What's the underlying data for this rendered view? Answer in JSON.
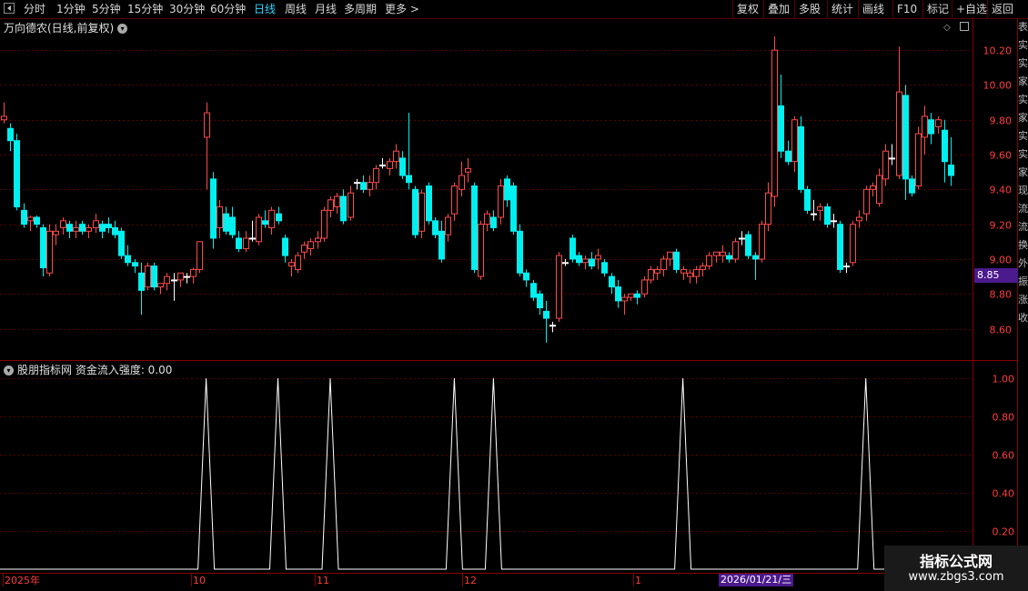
{
  "toolbar": {
    "left_items": [
      "分时",
      "1分钟",
      "5分钟",
      "15分钟",
      "30分钟",
      "60分钟",
      "日线",
      "周线",
      "月线",
      "多周期",
      "更多 >"
    ],
    "active": "日线",
    "right_items": [
      "复权",
      "叠加",
      "多股",
      "统计",
      "画线",
      "F10",
      "标记",
      "+自选",
      "返回"
    ]
  },
  "main_chart": {
    "title": "万向德农(日线,前复权)",
    "price_labels": [
      "10.20",
      "10.00",
      "9.80",
      "9.60",
      "9.40",
      "9.20",
      "9.00",
      "8.80",
      "8.60"
    ],
    "current_price": "8.85"
  },
  "indicator": {
    "title": "股朋指标网 资金流入强度: 0.00",
    "labels": [
      "1.00",
      "0.80",
      "0.60",
      "0.40",
      "0.20"
    ]
  },
  "x_axis": {
    "labels": [
      "2025年",
      "10",
      "11",
      "12",
      "1"
    ],
    "cursor_date": "2026/01/21/三"
  },
  "watermark": {
    "line1": "指标公式网",
    "line2": "www.zbgs3.com"
  },
  "right_panel_chars": [
    "表",
    "实",
    "实",
    "家",
    "实",
    "家",
    "实",
    "实",
    "家",
    "现",
    "流",
    "流",
    "换",
    "外",
    "振",
    "涨",
    "收"
  ],
  "colors": {
    "up": "#ff4a4a",
    "down": "#00f0f0",
    "neutral": "#ffffff",
    "grid": "#5a0000",
    "axis_text": "#ff3c3c",
    "active_tab": "#2dd4ff",
    "highlight": "#4b1a8c"
  },
  "chart_data": [
    {
      "type": "candlestick",
      "title": "万向德农(日线,前复权)",
      "ylim": [
        8.42,
        10.3
      ],
      "y_ticks": [
        10.2,
        10.0,
        9.8,
        9.6,
        9.4,
        9.2,
        9.0,
        8.8,
        8.6
      ],
      "current_price": 8.85,
      "x_tick_labels": [
        "2025年",
        "10",
        "11",
        "12",
        "1"
      ],
      "ohlc": [
        [
          9.8,
          9.9,
          9.78,
          9.82
        ],
        [
          9.75,
          9.78,
          9.62,
          9.68
        ],
        [
          9.68,
          9.72,
          9.28,
          9.3
        ],
        [
          9.28,
          9.32,
          9.18,
          9.2
        ],
        [
          9.22,
          9.25,
          9.16,
          9.24
        ],
        [
          9.24,
          9.25,
          9.18,
          9.2
        ],
        [
          9.18,
          9.2,
          8.9,
          8.95
        ],
        [
          8.92,
          9.2,
          8.9,
          9.16
        ],
        [
          9.14,
          9.2,
          9.08,
          9.16
        ],
        [
          9.18,
          9.24,
          9.14,
          9.22
        ],
        [
          9.2,
          9.22,
          9.12,
          9.16
        ],
        [
          9.16,
          9.22,
          9.12,
          9.18
        ],
        [
          9.2,
          9.22,
          9.14,
          9.16
        ],
        [
          9.16,
          9.2,
          9.12,
          9.18
        ],
        [
          9.18,
          9.26,
          9.15,
          9.22
        ],
        [
          9.2,
          9.22,
          9.12,
          9.16
        ],
        [
          9.2,
          9.24,
          9.15,
          9.18
        ],
        [
          9.18,
          9.22,
          9.12,
          9.14
        ],
        [
          9.16,
          9.18,
          9.0,
          9.02
        ],
        [
          9.02,
          9.08,
          8.96,
          8.98
        ],
        [
          8.98,
          9.0,
          8.92,
          8.96
        ],
        [
          8.92,
          8.98,
          8.68,
          8.82
        ],
        [
          8.84,
          8.98,
          8.82,
          8.96
        ],
        [
          8.96,
          8.98,
          8.82,
          8.84
        ],
        [
          8.84,
          8.86,
          8.8,
          8.86
        ],
        [
          8.86,
          8.92,
          8.82,
          8.9
        ],
        [
          8.88,
          8.92,
          8.76,
          8.88
        ],
        [
          8.88,
          8.92,
          8.84,
          8.92
        ],
        [
          8.9,
          8.92,
          8.86,
          8.9
        ],
        [
          8.9,
          8.95,
          8.86,
          8.94
        ],
        [
          8.94,
          9.1,
          8.92,
          9.1
        ],
        [
          9.7,
          9.9,
          9.4,
          9.84
        ],
        [
          9.46,
          9.5,
          9.06,
          9.12
        ],
        [
          9.18,
          9.34,
          9.12,
          9.3
        ],
        [
          9.26,
          9.3,
          9.14,
          9.16
        ],
        [
          9.24,
          9.3,
          9.12,
          9.14
        ],
        [
          9.12,
          9.16,
          9.04,
          9.06
        ],
        [
          9.06,
          9.16,
          9.04,
          9.12
        ],
        [
          9.12,
          9.22,
          9.1,
          9.12
        ],
        [
          9.1,
          9.26,
          9.08,
          9.24
        ],
        [
          9.22,
          9.28,
          9.18,
          9.2
        ],
        [
          9.18,
          9.3,
          9.14,
          9.28
        ],
        [
          9.26,
          9.3,
          9.2,
          9.22
        ],
        [
          9.12,
          9.14,
          8.98,
          9.02
        ],
        [
          8.96,
          9.0,
          8.9,
          8.98
        ],
        [
          8.94,
          9.04,
          8.92,
          9.02
        ],
        [
          9.04,
          9.1,
          9.0,
          9.08
        ],
        [
          9.06,
          9.12,
          9.02,
          9.1
        ],
        [
          9.1,
          9.16,
          9.06,
          9.12
        ],
        [
          9.12,
          9.3,
          9.1,
          9.28
        ],
        [
          9.28,
          9.36,
          9.24,
          9.34
        ],
        [
          9.3,
          9.38,
          9.26,
          9.36
        ],
        [
          9.36,
          9.4,
          9.2,
          9.22
        ],
        [
          9.24,
          9.42,
          9.22,
          9.38
        ],
        [
          9.44,
          9.46,
          9.4,
          9.44
        ],
        [
          9.44,
          9.48,
          9.38,
          9.4
        ],
        [
          9.4,
          9.48,
          9.36,
          9.44
        ],
        [
          9.44,
          9.54,
          9.4,
          9.52
        ],
        [
          9.54,
          9.58,
          9.52,
          9.54
        ],
        [
          9.52,
          9.58,
          9.48,
          9.56
        ],
        [
          9.56,
          9.66,
          9.52,
          9.62
        ],
        [
          9.58,
          9.62,
          9.46,
          9.48
        ],
        [
          9.48,
          9.84,
          9.4,
          9.44
        ],
        [
          9.4,
          9.42,
          9.12,
          9.14
        ],
        [
          9.16,
          9.4,
          9.12,
          9.38
        ],
        [
          9.42,
          9.44,
          9.2,
          9.22
        ],
        [
          9.22,
          9.24,
          9.12,
          9.14
        ],
        [
          9.16,
          9.22,
          8.98,
          9.0
        ],
        [
          9.14,
          9.26,
          9.1,
          9.24
        ],
        [
          9.26,
          9.44,
          9.22,
          9.42
        ],
        [
          9.4,
          9.56,
          9.36,
          9.48
        ],
        [
          9.5,
          9.58,
          9.44,
          9.52
        ],
        [
          9.42,
          9.44,
          8.92,
          8.94
        ],
        [
          8.9,
          9.22,
          8.88,
          9.2
        ],
        [
          9.2,
          9.28,
          9.16,
          9.26
        ],
        [
          9.24,
          9.28,
          9.16,
          9.18
        ],
        [
          9.24,
          9.46,
          9.2,
          9.42
        ],
        [
          9.46,
          9.48,
          9.3,
          9.34
        ],
        [
          9.42,
          9.44,
          9.14,
          9.16
        ],
        [
          9.16,
          9.2,
          8.9,
          8.92
        ],
        [
          8.92,
          8.94,
          8.84,
          8.88
        ],
        [
          8.86,
          8.88,
          8.76,
          8.78
        ],
        [
          8.8,
          8.82,
          8.68,
          8.72
        ],
        [
          8.7,
          8.76,
          8.52,
          8.66
        ],
        [
          8.62,
          8.64,
          8.58,
          8.62
        ],
        [
          8.66,
          9.04,
          8.64,
          9.02
        ],
        [
          8.98,
          9.0,
          8.96,
          8.98
        ],
        [
          9.12,
          9.14,
          8.98,
          9.0
        ],
        [
          9.02,
          9.04,
          8.96,
          8.98
        ],
        [
          8.98,
          9.02,
          8.94,
          9.0
        ],
        [
          9.0,
          9.04,
          8.94,
          8.96
        ],
        [
          9.0,
          9.06,
          8.94,
          9.02
        ],
        [
          8.98,
          9.0,
          8.9,
          8.92
        ],
        [
          8.9,
          8.92,
          8.8,
          8.84
        ],
        [
          8.84,
          8.88,
          8.72,
          8.76
        ],
        [
          8.76,
          8.8,
          8.68,
          8.78
        ],
        [
          8.78,
          8.8,
          8.76,
          8.8
        ],
        [
          8.8,
          8.82,
          8.74,
          8.78
        ],
        [
          8.8,
          8.9,
          8.78,
          8.88
        ],
        [
          8.88,
          8.96,
          8.86,
          8.94
        ],
        [
          8.92,
          8.96,
          8.88,
          8.94
        ],
        [
          8.94,
          9.02,
          8.9,
          9.0
        ],
        [
          9.0,
          9.04,
          8.96,
          9.04
        ],
        [
          9.04,
          9.06,
          8.92,
          8.94
        ],
        [
          8.92,
          8.96,
          8.88,
          8.94
        ],
        [
          8.9,
          8.94,
          8.86,
          8.92
        ],
        [
          8.9,
          8.96,
          8.86,
          8.94
        ],
        [
          8.94,
          8.98,
          8.9,
          8.96
        ],
        [
          8.96,
          9.04,
          8.94,
          9.02
        ],
        [
          9.02,
          9.04,
          8.98,
          9.04
        ],
        [
          9.02,
          9.08,
          8.98,
          9.04
        ],
        [
          9.02,
          9.04,
          8.98,
          9.0
        ],
        [
          9.0,
          9.12,
          8.98,
          9.1
        ],
        [
          9.12,
          9.16,
          9.08,
          9.12
        ],
        [
          9.14,
          9.16,
          9.0,
          9.02
        ],
        [
          9.02,
          9.04,
          8.88,
          9.0
        ],
        [
          9.0,
          9.22,
          8.98,
          9.2
        ],
        [
          9.2,
          9.44,
          9.16,
          9.38
        ],
        [
          9.36,
          10.28,
          9.3,
          10.2
        ],
        [
          9.88,
          10.06,
          9.58,
          9.62
        ],
        [
          9.62,
          9.68,
          9.54,
          9.56
        ],
        [
          9.56,
          9.82,
          9.5,
          9.8
        ],
        [
          9.76,
          9.82,
          9.38,
          9.4
        ],
        [
          9.4,
          9.42,
          9.26,
          9.28
        ],
        [
          9.26,
          9.34,
          9.22,
          9.26
        ],
        [
          9.28,
          9.32,
          9.22,
          9.3
        ],
        [
          9.3,
          9.32,
          9.18,
          9.2
        ],
        [
          9.22,
          9.26,
          9.18,
          9.22
        ],
        [
          9.2,
          9.22,
          8.92,
          8.94
        ],
        [
          8.96,
          8.98,
          8.92,
          8.96
        ],
        [
          8.98,
          9.22,
          8.96,
          9.2
        ],
        [
          9.22,
          9.28,
          9.18,
          9.24
        ],
        [
          9.26,
          9.42,
          9.22,
          9.4
        ],
        [
          9.4,
          9.44,
          9.36,
          9.42
        ],
        [
          9.32,
          9.52,
          9.3,
          9.48
        ],
        [
          9.46,
          9.66,
          9.42,
          9.62
        ],
        [
          9.58,
          9.66,
          9.54,
          9.58
        ],
        [
          9.48,
          10.22,
          9.46,
          9.96
        ],
        [
          9.94,
          10.0,
          9.34,
          9.46
        ],
        [
          9.46,
          9.48,
          9.36,
          9.38
        ],
        [
          9.42,
          9.76,
          9.4,
          9.72
        ],
        [
          9.7,
          9.88,
          9.6,
          9.82
        ],
        [
          9.8,
          9.84,
          9.66,
          9.72
        ],
        [
          9.76,
          9.82,
          9.72,
          9.8
        ],
        [
          9.74,
          9.8,
          9.44,
          9.56
        ],
        [
          9.54,
          9.7,
          9.42,
          9.48
        ]
      ]
    },
    {
      "type": "line",
      "title": "股朋指标网 资金流入强度",
      "ylim": [
        0,
        1.05
      ],
      "y_ticks": [
        1.0,
        0.8,
        0.6,
        0.4,
        0.2
      ],
      "spike_bars": [
        31,
        42,
        50,
        69,
        75,
        104,
        132
      ],
      "spike_value": 1.0,
      "baseline": 0.0
    }
  ]
}
